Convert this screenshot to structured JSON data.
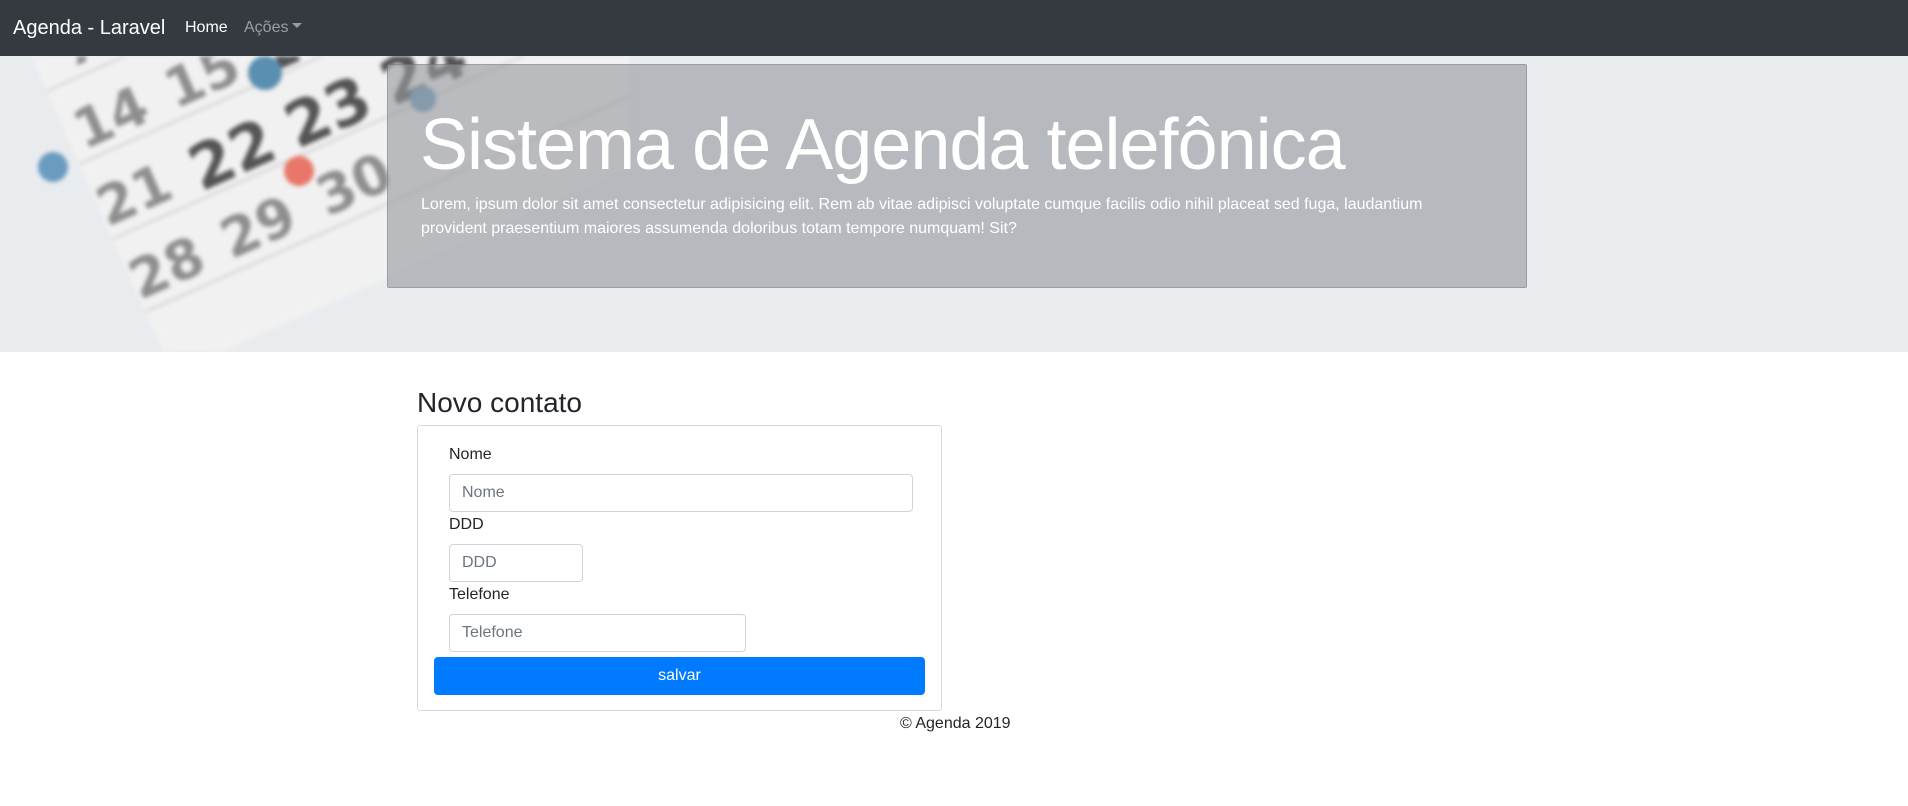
{
  "navbar": {
    "brand": "Agenda - Laravel",
    "links": [
      {
        "label": "Home"
      },
      {
        "label": "Ações"
      }
    ]
  },
  "hero": {
    "title": "Sistema de Agenda telefônica",
    "text": "Lorem, ipsum dolor sit amet consectetur adipisicing elit. Rem ab vitae adipisci voluptate cumque facilis odio nihil placeat sed fuga, laudantium provident praesentium maiores assumenda doloribus totam tempore numquam! Sit?"
  },
  "form": {
    "title": "Novo contato",
    "fields": [
      {
        "label": "Nome",
        "placeholder": "Nome",
        "value": ""
      },
      {
        "label": "DDD",
        "placeholder": "DDD",
        "value": ""
      },
      {
        "label": "Telefone",
        "placeholder": "Telefone",
        "value": ""
      }
    ],
    "submit_label": "salvar"
  },
  "footer": {
    "text": "© Agenda 2019"
  },
  "colors": {
    "navbar": "#343a40",
    "primary": "#007bff",
    "jumbotron": "#e9ecef"
  }
}
